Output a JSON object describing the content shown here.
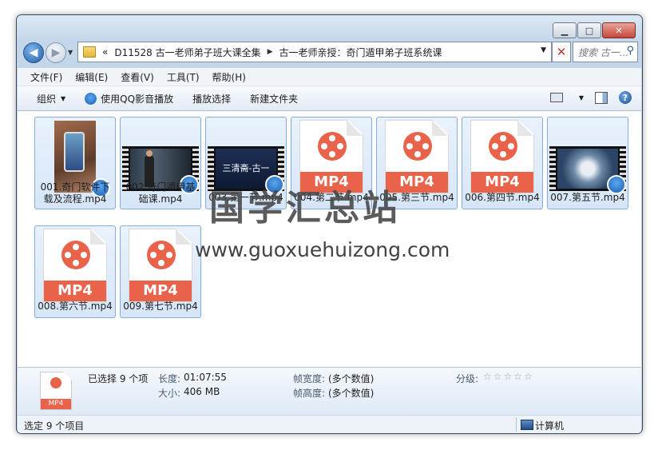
{
  "window": {
    "minimize": "▁",
    "maximize": "□",
    "close": "✕"
  },
  "address": {
    "crumbs_prefix": "«",
    "crumb1": "D11528 古一老师弟子班大课全集",
    "crumb2": "古一老师亲授：奇门遁甲弟子班系统课",
    "search_placeholder": "搜索 古一..."
  },
  "menu": [
    "文件(F)",
    "编辑(E)",
    "查看(V)",
    "工具(T)",
    "帮助(H)"
  ],
  "toolbar": {
    "organize": "组织",
    "qq_play": "使用QQ影音播放",
    "play_selection": "播放选择",
    "new_folder": "新建文件夹"
  },
  "files": [
    {
      "name_line1": "001.奇门软件下",
      "name_line2": "载及流程.mp4",
      "thumb": "photo"
    },
    {
      "name_line1": "002.奇门遁甲基",
      "name_line2": "础课.mp4",
      "thumb": "video-lecture"
    },
    {
      "name_line1": "003.第一节.mp4",
      "name_line2": "",
      "thumb": "video-title",
      "thumb_text": "三清斋-古一"
    },
    {
      "name_line1": "004.第二节.mp4",
      "name_line2": "",
      "thumb": "mp4-doc",
      "doc_text": "MP4"
    },
    {
      "name_line1": "005.第三节.mp4",
      "name_line2": "",
      "thumb": "mp4-doc",
      "doc_text": "MP4"
    },
    {
      "name_line1": "006.第四节.mp4",
      "name_line2": "",
      "thumb": "mp4-doc",
      "doc_text": "MP4"
    },
    {
      "name_line1": "007.第五节.mp4",
      "name_line2": "",
      "thumb": "video-yinyang"
    },
    {
      "name_line1": "008.第六节.mp4",
      "name_line2": "",
      "thumb": "mp4-doc",
      "doc_text": "MP4"
    },
    {
      "name_line1": "009.第七节.mp4",
      "name_line2": "",
      "thumb": "mp4-doc",
      "doc_text": "MP4"
    }
  ],
  "watermark": {
    "cn": "国学汇总站",
    "url": "www.guoxuehuizong.com"
  },
  "details": {
    "icon_text": "MP4",
    "selected": "已选择 9 个项",
    "duration_label": "长度:",
    "duration_value": "01:07:55",
    "size_label": "大小:",
    "size_value": "406 MB",
    "frame_width_label": "帧宽度:",
    "frame_width_value": "(多个数值)",
    "frame_height_label": "帧高度:",
    "frame_height_value": "(多个数值)",
    "rating_label": "分级:",
    "rating_stars": "☆☆☆☆☆"
  },
  "status": {
    "left": "选定 9 个项目",
    "computer": "计算机"
  }
}
